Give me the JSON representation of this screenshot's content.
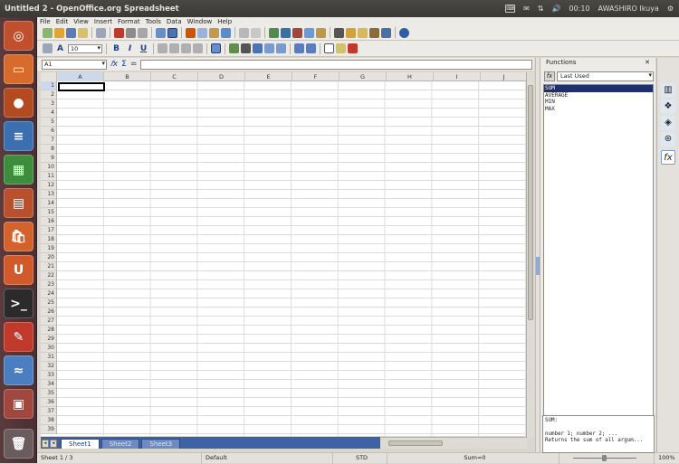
{
  "window": {
    "title": "Untitled 2 - OpenOffice.org Spreadsheet"
  },
  "tray": {
    "keyboard": "⌨",
    "mail": "✉",
    "network": "⇅",
    "volume": "🔊",
    "time": "00:10",
    "user": "AWASHIRO Ikuya",
    "power": "⚙"
  },
  "menu": [
    "File",
    "Edit",
    "View",
    "Insert",
    "Format",
    "Tools",
    "Data",
    "Window",
    "Help"
  ],
  "toolbar2": {
    "font_name": "",
    "font_size": "10"
  },
  "formula": {
    "namebox": "A1",
    "fx": "𝑓x",
    "sum": "Σ",
    "equals": "=",
    "value": ""
  },
  "columns": [
    "A",
    "B",
    "C",
    "D",
    "E",
    "F",
    "G",
    "H",
    "I",
    "J"
  ],
  "rows": [
    "1",
    "2",
    "3",
    "4",
    "5",
    "6",
    "7",
    "8",
    "9",
    "10",
    "11",
    "12",
    "13",
    "14",
    "15",
    "16",
    "17",
    "18",
    "19",
    "20",
    "21",
    "22",
    "23",
    "24",
    "25",
    "26",
    "27",
    "28",
    "29",
    "30",
    "31",
    "32",
    "33",
    "34",
    "35",
    "36",
    "37",
    "38",
    "39"
  ],
  "sheets": [
    "Sheet1",
    "Sheet2",
    "Sheet3"
  ],
  "status": {
    "sheet": "Sheet 1 / 3",
    "style": "Default",
    "mode": "STD",
    "sum": "Sum=0",
    "zoom": "100%"
  },
  "functions_panel": {
    "title": "Functions",
    "close": "✕",
    "category": "Last Used",
    "items": [
      "SUM",
      "AVERAGE",
      "MIN",
      "MAX"
    ],
    "selected": "SUM",
    "desc_name": "SUM:",
    "desc_args": "number 1; number 2; ...",
    "desc_text": " Returns the sum of all argum..."
  }
}
